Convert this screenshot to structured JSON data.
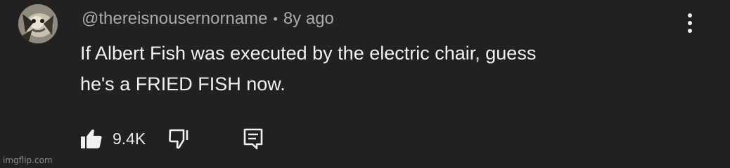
{
  "comment": {
    "author": "@thereisnousernorname",
    "separator": "•",
    "time_ago": "8y ago",
    "text_line1": "If Albert Fish was executed by the electric chair, guess",
    "text_line2": "he's a FRIED FISH now.",
    "like_count": "9.4K"
  },
  "icons": {
    "more": "more-vertical-icon",
    "like": "thumbs-up-icon",
    "dislike": "thumbs-down-icon",
    "reply": "reply-comment-icon"
  },
  "watermark": "imgflip.com"
}
